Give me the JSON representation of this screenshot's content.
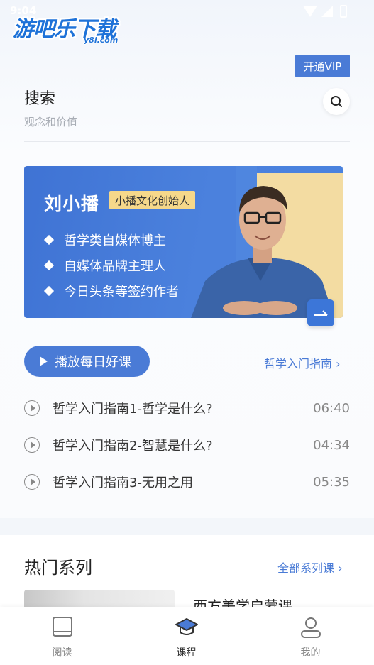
{
  "status_bar": {
    "time": "9:04"
  },
  "watermark": {
    "logo_text": "游吧乐下载",
    "logo_sub": "y8l.com"
  },
  "vip": {
    "label": "开通VIP"
  },
  "search": {
    "title": "搜索",
    "subtitle": "观念和价值",
    "icon": "search-icon"
  },
  "banner": {
    "name": "刘小播",
    "tag": "小播文化创始人",
    "bullets": [
      "哲学类自媒体博主",
      "自媒体品牌主理人",
      "今日头条等签约作者"
    ],
    "arrow_icon": "arrow-right-icon"
  },
  "play": {
    "label": "播放每日好课",
    "guide_link": "哲学入门指南 ›"
  },
  "lessons": [
    {
      "title": "哲学入门指南1-哲学是什么?",
      "duration": "06:40"
    },
    {
      "title": "哲学入门指南2-智慧是什么?",
      "duration": "04:34"
    },
    {
      "title": "哲学入门指南3-无用之用",
      "duration": "05:35"
    }
  ],
  "hot": {
    "title": "热门系列",
    "all_link": "全部系列课 ›",
    "series_name": "西方美学启蒙课"
  },
  "nav": {
    "items": [
      {
        "label": "阅读",
        "icon": "book-icon",
        "active": false
      },
      {
        "label": "课程",
        "icon": "graduation-cap-icon",
        "active": true
      },
      {
        "label": "我的",
        "icon": "user-icon",
        "active": false
      }
    ]
  },
  "colors": {
    "accent": "#4a7bd6",
    "tag_yellow": "#f6d88a",
    "text_gray": "#888888"
  }
}
